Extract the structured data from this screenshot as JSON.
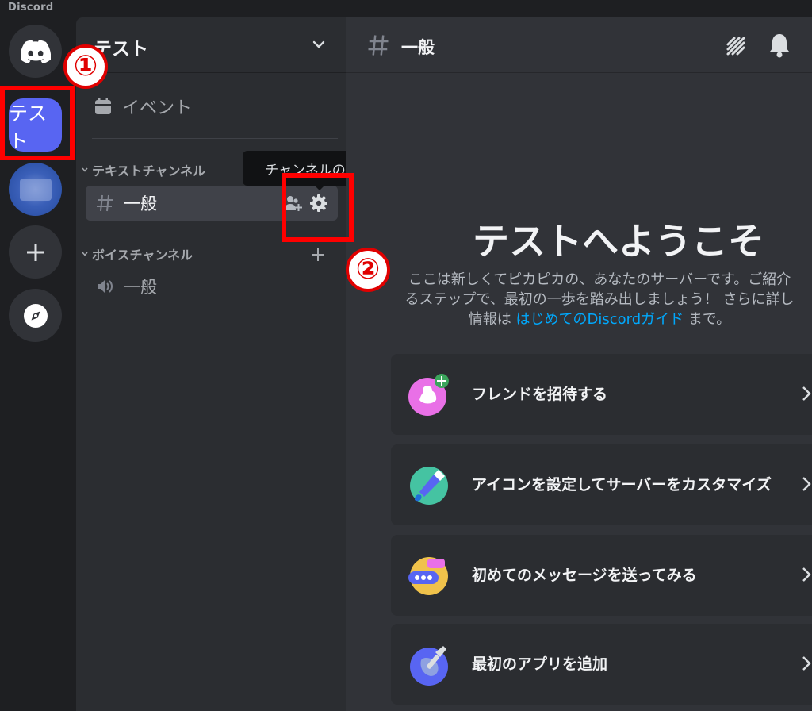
{
  "window": {
    "brand": "Discord"
  },
  "rail": {
    "servers": [
      {
        "label": "テスト"
      }
    ]
  },
  "sidebar": {
    "server_name": "テスト",
    "events_label": "イベント",
    "text_category": "テキストチャンネル",
    "voice_category": "ボイスチャンネル",
    "text_channel": "一般",
    "voice_channel": "一般",
    "tooltip": "チャンネルの編集"
  },
  "main": {
    "channel_title": "一般",
    "welcome_title": "テストへようこそ",
    "desc_line1": "ここは新しくてピカピカの、あなたのサーバーです。ご紹介",
    "desc_line2": "るステップで、最初の一歩を踏み出しましょう！ さらに詳し",
    "desc_line3_pre": "情報は",
    "desc_link": "はじめてのDiscordガイド",
    "desc_line3_post": "まで。",
    "cards": [
      {
        "label": "フレンドを招待する"
      },
      {
        "label": "アイコンを設定してサーバーをカスタマイズ"
      },
      {
        "label": "初めてのメッセージを送ってみる"
      },
      {
        "label": "最初のアプリを追加"
      }
    ]
  },
  "annotations": {
    "one": "①",
    "two": "②"
  },
  "colors": {
    "accent": "#5865f2",
    "annotation": "#ff0000",
    "link": "#00a8fc"
  }
}
